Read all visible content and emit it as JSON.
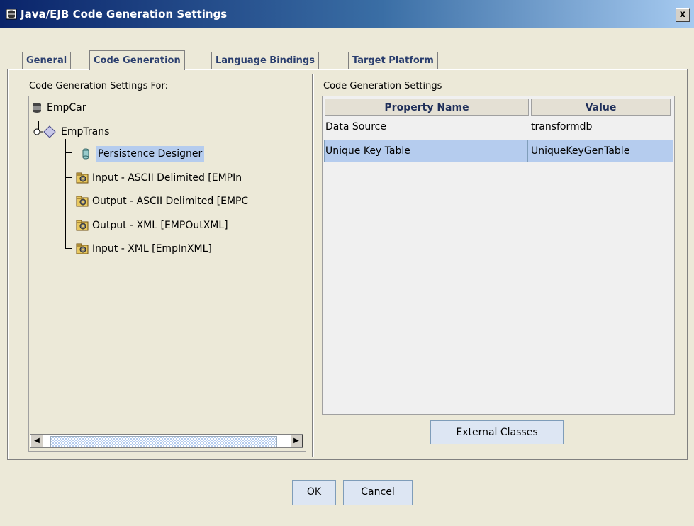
{
  "window": {
    "title": "Java/EJB Code Generation Settings",
    "close_label": "x"
  },
  "tabs": [
    {
      "label": "General",
      "active": false
    },
    {
      "label": "Code Generation",
      "active": true
    },
    {
      "label": "Language Bindings",
      "active": false
    },
    {
      "label": "Target Platform",
      "active": false
    }
  ],
  "left_panel": {
    "label": "Code Generation Settings For:",
    "tree": [
      {
        "label": "EmpCar",
        "icon": "database-icon",
        "level": 0
      },
      {
        "label": "EmpTrans",
        "icon": "diamond-icon",
        "level": 0
      },
      {
        "label": "Persistence Designer",
        "icon": "cylinder-icon",
        "level": 1,
        "selected": true
      },
      {
        "label": "Input - ASCII Delimited [EMPIn",
        "icon": "folder-gear-icon",
        "level": 1
      },
      {
        "label": "Output - ASCII Delimited [EMPC",
        "icon": "folder-gear-icon",
        "level": 1
      },
      {
        "label": "Output - XML [EMPOutXML]",
        "icon": "folder-gear-icon",
        "level": 1
      },
      {
        "label": "Input - XML [EmpInXML]",
        "icon": "folder-gear-icon",
        "level": 1
      }
    ]
  },
  "right_panel": {
    "label": "Code Generation Settings",
    "columns": [
      "Property Name",
      "Value"
    ],
    "rows": [
      {
        "name": "Data Source",
        "value": "transformdb"
      },
      {
        "name": "Unique Key Table",
        "value": "UniqueKeyGenTable"
      }
    ],
    "external_button": "External Classes"
  },
  "buttons": {
    "ok": "OK",
    "cancel": "Cancel"
  },
  "colors": {
    "titlebar": "#0a246a",
    "selection": "#b5ccee",
    "background": "#ece9d8"
  }
}
